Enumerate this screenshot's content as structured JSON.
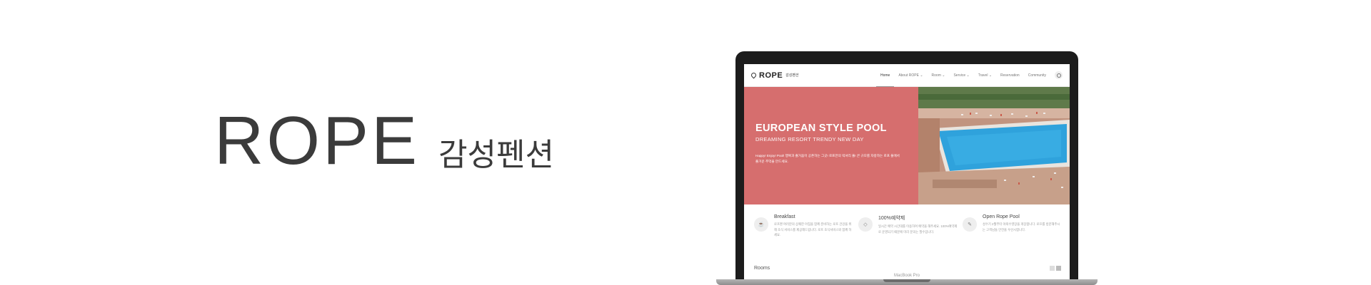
{
  "brand": {
    "logo": "ROPE",
    "subtitle": "감성펜션"
  },
  "device": {
    "label": "MacBook Pro"
  },
  "site": {
    "logo_name": "ROPE",
    "logo_sub": "감성펜션",
    "menu": [
      "Home",
      "About ROPE ⌄",
      "Room ⌄",
      "Service ⌄",
      "Travel ⌄",
      "Reservation",
      "Community"
    ],
    "active_menu": "Home",
    "hero": {
      "title": "EUROPEAN STYLE POOL",
      "subtitle": "DREAMING RESORT TRENDY NEW DAY",
      "description": "Happy! Enjoy! Pool! 행복과 즐거움이 공존하는 그곳! 로프만의 럭셔리 풀! 큰 규모를 자랑하는 로프 풀에서 즐거운 추억을 만드세요.",
      "accent": "#d66e6e"
    },
    "features": [
      {
        "icon": "cup-icon",
        "glyph": "☕",
        "title": "Breakfast",
        "desc": "로프펜 여러분의 상쾌한 아침을 함께 준비하는 로프 건강을 위해 조식 서비스를 제공해드립니다. 로프 조식서비스와 함께 하세요."
      },
      {
        "icon": "diamond-icon",
        "glyph": "◇",
        "title": "100%예약제",
        "desc": "일시간 예약 시간대를 이용하여 예약을 해주세요. 100%예약제로 운영되기 때문에 미리 문의는 필수입니다."
      },
      {
        "icon": "wrench-icon",
        "glyph": "✎",
        "title": "Open Rope Pool",
        "desc": "성수기 2월부터 야외수영장을 개장합니다. 로프를 방문해주시는 고객님들 안전을 우선시합니다."
      }
    ],
    "rooms_label": "Rooms"
  }
}
